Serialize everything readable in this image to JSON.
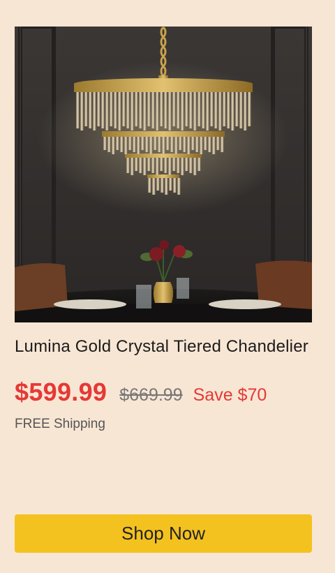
{
  "product": {
    "title": "Lumina Gold Crystal Tiered Chandelier",
    "image_alt": "product-photo",
    "price": "$599.99",
    "original_price": "$669.99",
    "savings": "Save $70",
    "shipping": "FREE Shipping"
  },
  "cta": {
    "label": "Shop Now"
  },
  "colors": {
    "background": "#f8e6d4",
    "price": "#e53935",
    "button": "#f4c21f"
  }
}
